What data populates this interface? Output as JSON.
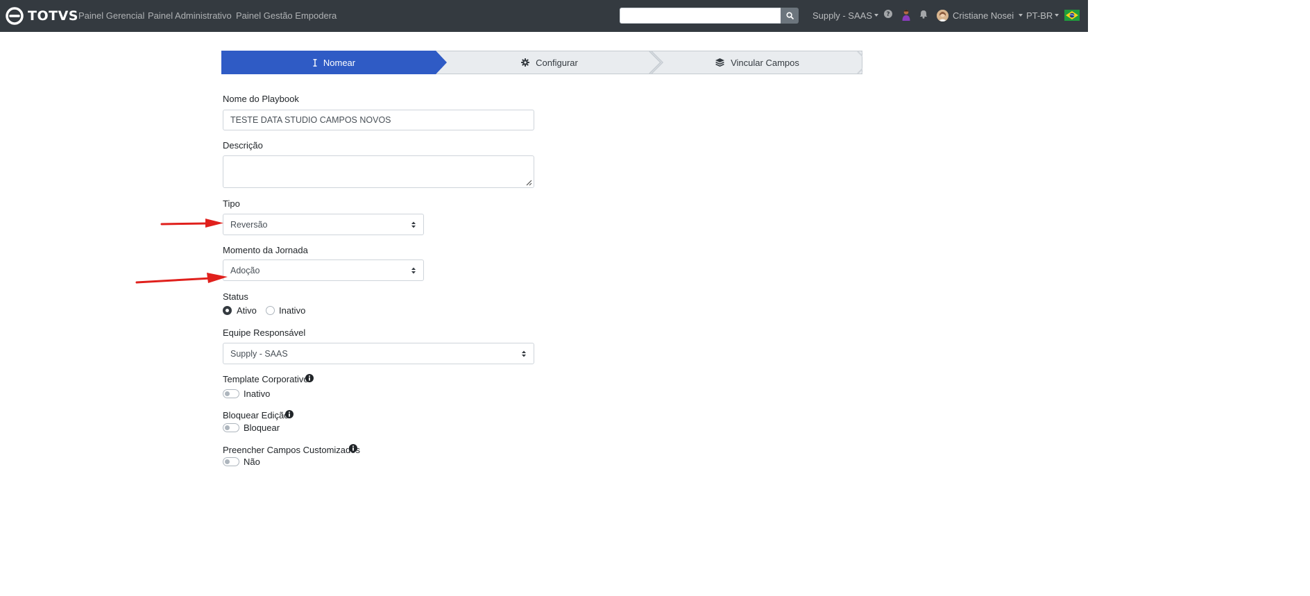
{
  "navbar": {
    "brand": "TOTVS",
    "links": [
      "Painel Gerencial",
      "Painel Administrativo",
      "Painel Gestão Empodera"
    ],
    "search": {
      "value": "",
      "placeholder": ""
    },
    "team_dropdown": "Supply - SAAS",
    "user_name": "Cristiane Nosei",
    "language": "PT-BR",
    "icons": [
      "search-icon",
      "help-icon",
      "person-icon",
      "bell-icon",
      "avatar",
      "brazil-flag"
    ],
    "colors": {
      "background": "#343a40"
    }
  },
  "stepper": {
    "steps": [
      {
        "label": "Nomear",
        "icon": "text-cursor-icon",
        "active": true
      },
      {
        "label": "Configurar",
        "icon": "gear-icon",
        "active": false
      },
      {
        "label": "Vincular Campos",
        "icon": "layers-icon",
        "active": false
      }
    ],
    "colors": {
      "active": "#2f5bc5",
      "inactive": "#e9ecef"
    }
  },
  "form": {
    "playbook_name": {
      "label": "Nome do Playbook",
      "value": "TESTE DATA STUDIO CAMPOS NOVOS"
    },
    "description": {
      "label": "Descrição",
      "value": ""
    },
    "tipo": {
      "label": "Tipo",
      "selected": "Reversão"
    },
    "momento": {
      "label": "Momento da Jornada",
      "selected": "Adoção"
    },
    "status": {
      "label": "Status",
      "options": [
        "Ativo",
        "Inativo"
      ],
      "selected": "Ativo"
    },
    "equipe": {
      "label": "Equipe Responsável",
      "selected": "Supply - SAAS"
    },
    "template": {
      "label": "Template Corporativo",
      "state_label": "Inativo",
      "on": false
    },
    "bloquear": {
      "label": "Bloquear Edição",
      "state_label": "Bloquear",
      "on": false
    },
    "preencher": {
      "label": "Preencher Campos Customizados",
      "state_label": "Não",
      "on": false
    }
  },
  "annotations": {
    "arrow_color": "#e0201c",
    "arrows": [
      "arrow-to-tipo",
      "arrow-to-momento"
    ]
  }
}
